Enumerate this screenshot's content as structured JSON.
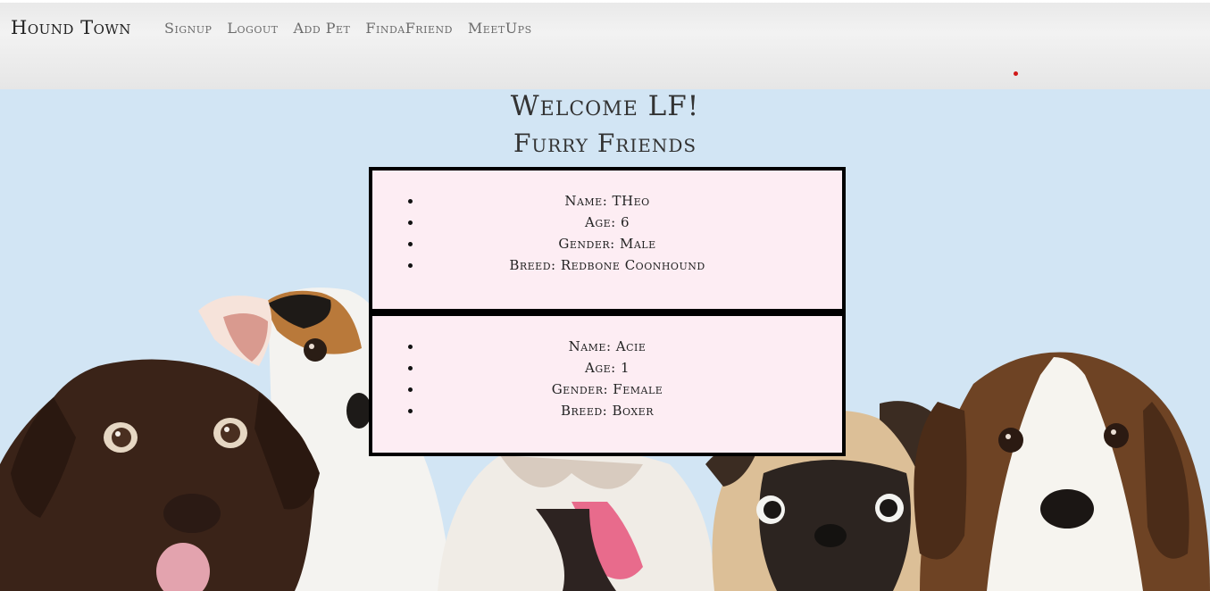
{
  "navbar": {
    "brand": "Hound Town",
    "links": [
      "Signup",
      "Logout",
      "Add Pet",
      "FindaFriend",
      "MeetUps"
    ]
  },
  "main": {
    "welcome": "Welcome LF!",
    "subtitle": "Furry Friends",
    "pets": [
      {
        "name_line": "Name: THeo",
        "age_line": "Age: 6",
        "gender_line": "Gender: Male",
        "breed_line": "Breed: Redbone Coonhound"
      },
      {
        "name_line": "Name: Acie",
        "age_line": "Age: 1",
        "gender_line": "Gender: Female",
        "breed_line": "Breed: Boxer"
      }
    ]
  },
  "colors": {
    "background": "#d2e5f4",
    "card_background": "#fdedf3",
    "card_border": "#000000",
    "navbar_background": "#ececec",
    "nav_link": "#6b6b6b"
  }
}
